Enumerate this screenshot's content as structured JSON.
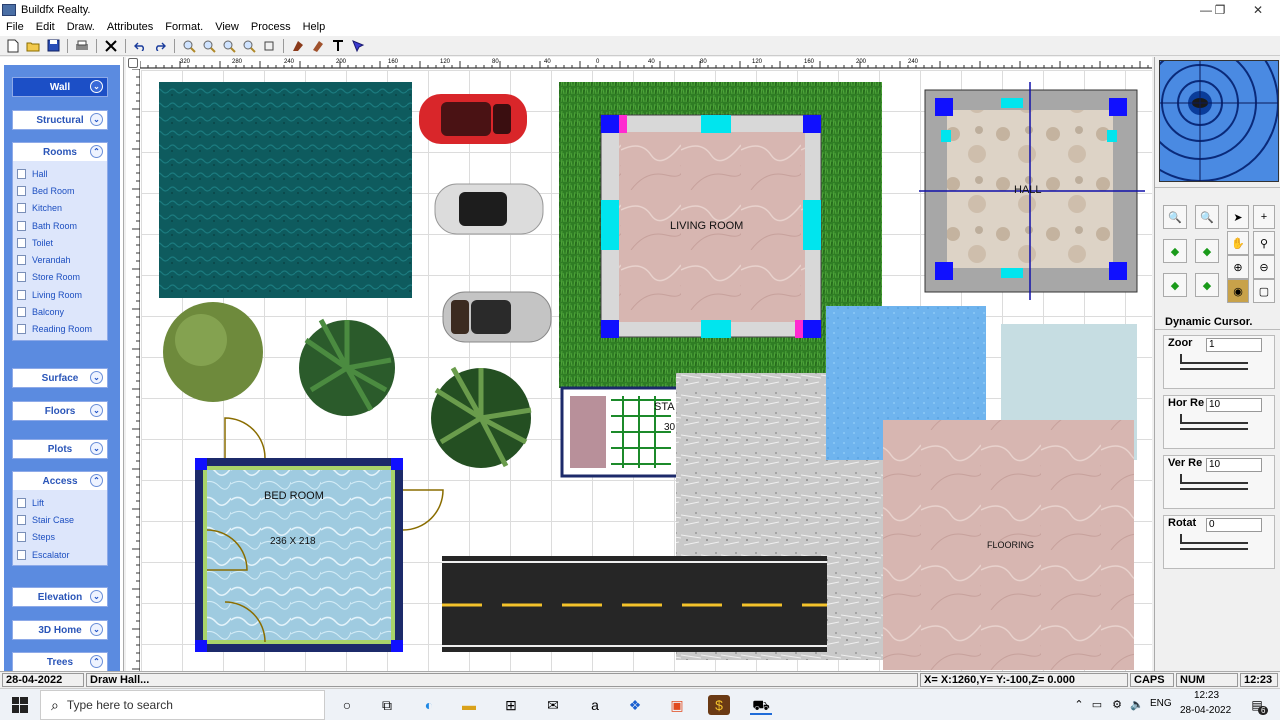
{
  "window": {
    "title": "Buildfx Realty.",
    "minimize": "—",
    "maximize": "❐",
    "close": "✕"
  },
  "menu": [
    "File",
    "Edit",
    "Draw.",
    "Attributes",
    "Format.",
    "View",
    "Process",
    "Help"
  ],
  "toolbar": {
    "icons": [
      "new-icon",
      "open-icon",
      "save-icon",
      "print-icon",
      "close-x-icon",
      "undo-icon",
      "redo-icon",
      "zoom-icons",
      "brush-icons",
      "text-icon",
      "pointer-icon"
    ]
  },
  "sidebar": {
    "groups": [
      {
        "label": "Wall",
        "state": "collapsed",
        "active": true
      },
      {
        "label": "Structural",
        "state": "collapsed"
      },
      {
        "label": "Rooms",
        "state": "expanded",
        "items": [
          "Hall",
          "Bed Room",
          "Kitchen",
          "Bath Room",
          "Toilet",
          "Verandah",
          "Store Room",
          "Living Room",
          "Balcony",
          "Reading Room"
        ]
      },
      {
        "label": "Surface",
        "state": "collapsed"
      },
      {
        "label": "Floors",
        "state": "collapsed"
      },
      {
        "label": "Plots",
        "state": "collapsed"
      },
      {
        "label": "Access",
        "state": "expanded",
        "items": [
          "Lift",
          "Stair Case",
          "Steps",
          "Escalator"
        ]
      },
      {
        "label": "Elevation",
        "state": "collapsed"
      },
      {
        "label": "3D Home",
        "state": "collapsed"
      },
      {
        "label": "Trees",
        "state": "expanded"
      }
    ]
  },
  "ruler": {
    "top_labels": [
      "320",
      "280",
      "240",
      "200",
      "160",
      "120",
      "80",
      "40",
      "0",
      "40",
      "80",
      "120",
      "160",
      "200",
      "240"
    ]
  },
  "canvas": {
    "labels": {
      "living_room": "LIVING ROOM",
      "hall": "HALL",
      "bed_room": "BED ROOM",
      "bed_room_size": "236 X 218",
      "flooring": "FLOORING",
      "stair": "STA",
      "stair_num": "30"
    },
    "colors": {
      "water": "#0e5b5e",
      "grass": "#2f7d24",
      "marble": "#d9b7b0",
      "wall_accent": "#00e5ee",
      "wall_pink": "#ff2ad0",
      "wall_blue": "#1010ff"
    }
  },
  "rightpanel": {
    "title": "Dynamic Cursor.",
    "controls": [
      {
        "label": "Zoor",
        "value": "1"
      },
      {
        "label": "Hor Re",
        "value": "10"
      },
      {
        "label": "Ver Re",
        "value": "10"
      },
      {
        "label": "Rotat",
        "value": "0"
      }
    ]
  },
  "status": {
    "date": "28-04-2022",
    "action": "Draw Hall...",
    "coords": "X= X:1260,Y= Y:-100,Z= 0.000",
    "caps": "CAPS",
    "num": "NUM",
    "time": "12:23"
  },
  "taskbar": {
    "search_placeholder": "Type here to search",
    "lang": "ENG",
    "time": "12:23",
    "date": "28-04-2022",
    "notif_count": "6"
  }
}
